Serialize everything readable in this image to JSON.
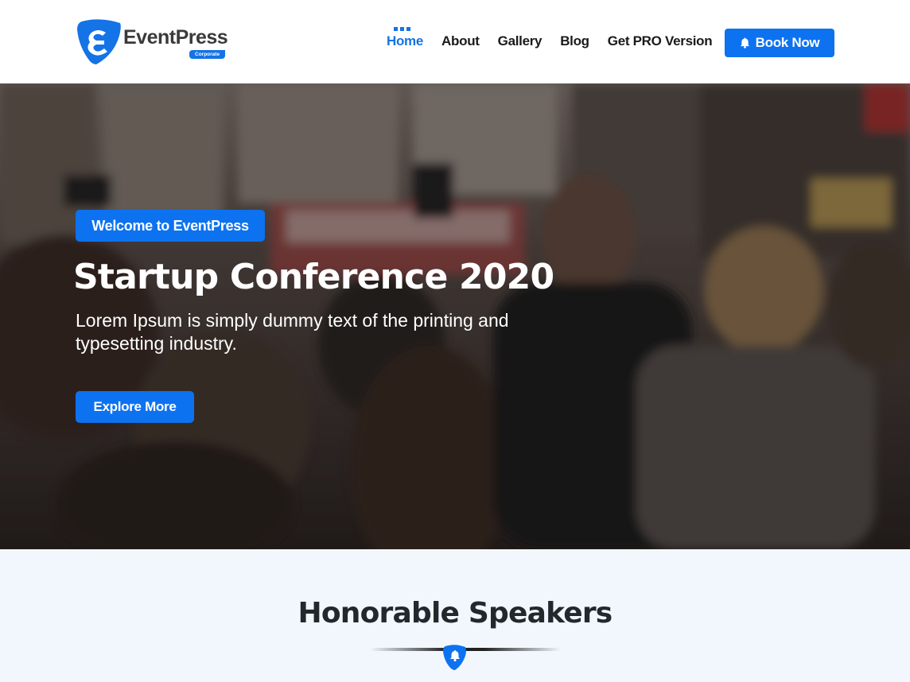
{
  "header": {
    "logo": {
      "wordmark": "EventPress",
      "badge": "Corporate",
      "letter": "E"
    },
    "nav": [
      {
        "label": "Home",
        "active": true
      },
      {
        "label": "About",
        "active": false
      },
      {
        "label": "Gallery",
        "active": false
      },
      {
        "label": "Blog",
        "active": false
      },
      {
        "label": "Get PRO Version",
        "active": false
      }
    ],
    "book_button": {
      "label": "Book Now",
      "icon": "bell-icon"
    }
  },
  "hero": {
    "badge": "Welcome to EventPress",
    "title": "Startup Conference 2020",
    "text": "Lorem Ipsum is simply dummy text of the printing and typesetting industry.",
    "button": "Explore More"
  },
  "speakers": {
    "title": "Honorable Speakers",
    "divider_icon": "bell-icon"
  },
  "colors": {
    "accent": "#0d72f0",
    "heading": "#23282d",
    "section_bg": "#f2f7fe"
  }
}
